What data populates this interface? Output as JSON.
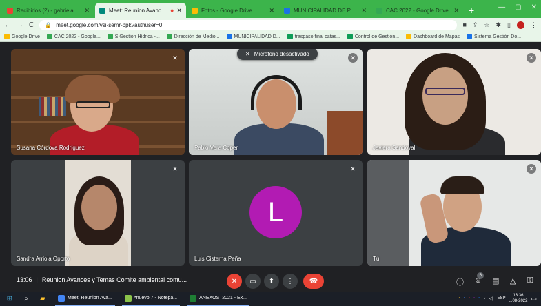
{
  "browser": {
    "tabs": [
      {
        "title": "Recibidos (2) - gabriela.ruiz@g...",
        "active": false,
        "color": "#ea4335"
      },
      {
        "title": "Meet: Reunion Avances y Te",
        "active": true,
        "color": "#00897b"
      },
      {
        "title": "Fotos - Google Drive",
        "active": false,
        "color": "#fbbc04"
      },
      {
        "title": "MUNICIPALIDAD DE PEÑALOLÉN",
        "active": false,
        "color": "#1a73e8"
      },
      {
        "title": "CAC 2022 - Google Drive",
        "active": false,
        "color": "#34a853"
      }
    ],
    "url": "meet.google.com/vsi-semr-bpk?authuser=0",
    "bookmarks": [
      {
        "label": "Google Drive",
        "color": "#fbbc04"
      },
      {
        "label": "CAC 2022 - Google...",
        "color": "#34a853"
      },
      {
        "label": "S Gestión Hídrica -...",
        "color": "#34a853"
      },
      {
        "label": "Dirección de Medio...",
        "color": "#34a853"
      },
      {
        "label": "MUNICIPALIDAD D...",
        "color": "#1a73e8"
      },
      {
        "label": "traspaso final catas...",
        "color": "#0f9d58"
      },
      {
        "label": "Control de Gestión...",
        "color": "#0f9d58"
      },
      {
        "label": "Dashboard de Mapas",
        "color": "#fbbc04"
      },
      {
        "label": "Sistema Gestión Do...",
        "color": "#1a73e8"
      }
    ]
  },
  "meet": {
    "toast": "Micrófono desactivado",
    "participants": [
      {
        "name": "Susana Córdova Rodríguez"
      },
      {
        "name": "Pablo Vera Coper"
      },
      {
        "name": "Javiera Sandoval"
      },
      {
        "name": "Sandra Arriola Oporto"
      },
      {
        "name": "Luis Cisterna Peña",
        "initial": "L"
      },
      {
        "name": "Tú"
      }
    ],
    "time": "13:06",
    "meeting_title": "Reunion Avances y Temas Comite ambiental comu...",
    "people_count": "6"
  },
  "taskbar": {
    "apps": [
      {
        "label": "Meet: Reunion Ava...",
        "color": "#4285f4"
      },
      {
        "label": "*nuevo 7 - Notepa...",
        "color": "#8bc34a"
      },
      {
        "label": "ANEXOS_2021 - Ex...",
        "color": "#1e7e34"
      }
    ],
    "lang": "ESP",
    "clock_time": "13:36",
    "clock_date": "...08-2022"
  }
}
